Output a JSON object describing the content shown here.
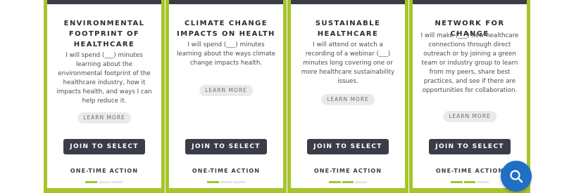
{
  "cards": [
    {
      "title": "ENVIRONMENTAL FOOTPRINT OF HEALTHCARE",
      "description": "I will spend (___) minutes learning about the environmental footprint of the healthcare industry, how it impacts health, and ways I can help reduce it.",
      "learn_more": "LEARN MORE",
      "join": "JOIN TO SELECT",
      "action_type": "ONE-TIME ACTION",
      "progress": 0.33
    },
    {
      "title": "CLIMATE CHANGE IMPACTS ON HEALTH",
      "description": "I will spend (___) minutes learning about the ways climate change impacts health.",
      "learn_more": "LEARN MORE",
      "join": "JOIN TO SELECT",
      "action_type": "ONE-TIME ACTION",
      "progress": 0.33
    },
    {
      "title": "SUSTAINABLE HEALTHCARE",
      "description": "I will attend or watch a recording of a webinar (___) minutes long covering one or more healthcare sustainability issues.",
      "learn_more": "LEARN MORE",
      "join": "JOIN TO SELECT",
      "action_type": "ONE-TIME ACTION",
      "progress": 0.67
    },
    {
      "title": "NETWORK FOR CHANGE",
      "description": "I will make (___) new healthcare connections through direct outreach or by joining a green team or industry group to learn from my peers, share best practices, and see if there are opportunities for collaboration.",
      "learn_more": "LEARN MORE",
      "join": "JOIN TO SELECT",
      "action_type": "ONE-TIME ACTION",
      "progress": 0.67
    }
  ],
  "colors": {
    "accent_green": "#a5c52a",
    "dark_button": "#3a3d47",
    "search_fab_blue": "#1f6fc5"
  },
  "search_fab_icon": "search-icon"
}
